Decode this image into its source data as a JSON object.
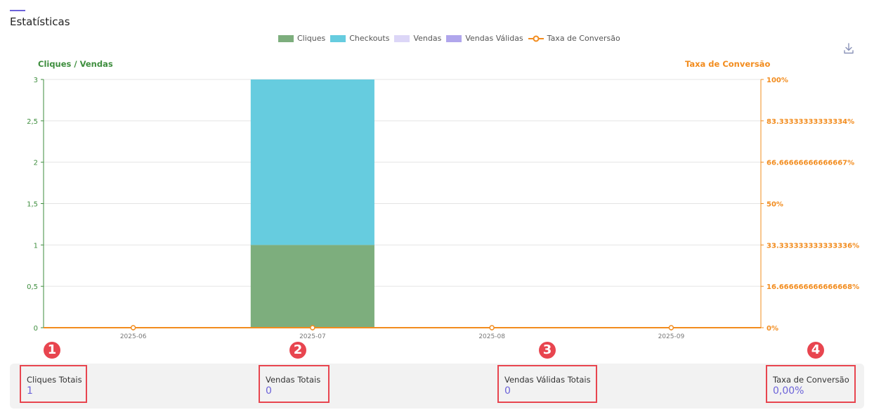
{
  "page": {
    "title": "Estatísticas"
  },
  "toolbar": {
    "download_icon": "download-icon"
  },
  "colors": {
    "cliques": "#7dae7d",
    "checkouts": "#66ccdf",
    "vendas": "#dcd6f7",
    "vendas_validas": "#b0a6ec",
    "taxa": "#f28c1e",
    "left_axis": "#3e8e3e",
    "right_axis": "#f28c1e",
    "accent": "#6c63d9",
    "marker": "#e8454f"
  },
  "chart_data": {
    "type": "bar",
    "stacked": true,
    "categories": [
      "2025-06",
      "2025-07",
      "2025-08",
      "2025-09"
    ],
    "series": [
      {
        "name": "Cliques",
        "type": "bar",
        "axis": "left",
        "values": [
          0,
          1,
          0,
          0
        ]
      },
      {
        "name": "Checkouts",
        "type": "bar",
        "axis": "left",
        "values": [
          0,
          2,
          0,
          0
        ]
      },
      {
        "name": "Vendas",
        "type": "bar",
        "axis": "left",
        "values": [
          0,
          0,
          0,
          0
        ]
      },
      {
        "name": "Vendas Válidas",
        "type": "bar",
        "axis": "left",
        "values": [
          0,
          0,
          0,
          0
        ]
      },
      {
        "name": "Taxa de Conversão",
        "type": "line",
        "axis": "right",
        "values": [
          0,
          0,
          0,
          0
        ]
      }
    ],
    "ylabel": "Cliques / Vendas",
    "ylim": [
      0,
      3
    ],
    "yticks": [
      "0",
      "0,5",
      "1",
      "1,5",
      "2",
      "2,5",
      "3"
    ],
    "y2label": "Taxa de Conversão",
    "y2lim": [
      0,
      100
    ],
    "y2ticks": [
      "0%",
      "16.666666666666668%",
      "33.333333333333336%",
      "50%",
      "66.66666666666667%",
      "83.33333333333334%",
      "100%"
    ],
    "grid": true,
    "legend": "top"
  },
  "summary": [
    {
      "label": "Cliques Totais",
      "value": "1",
      "marker": "1"
    },
    {
      "label": "Vendas Totais",
      "value": "0",
      "marker": "2"
    },
    {
      "label": "Vendas Válidas Totais",
      "value": "0",
      "marker": "3"
    },
    {
      "label": "Taxa de Conversão",
      "value": "0,00%",
      "marker": "4"
    }
  ]
}
